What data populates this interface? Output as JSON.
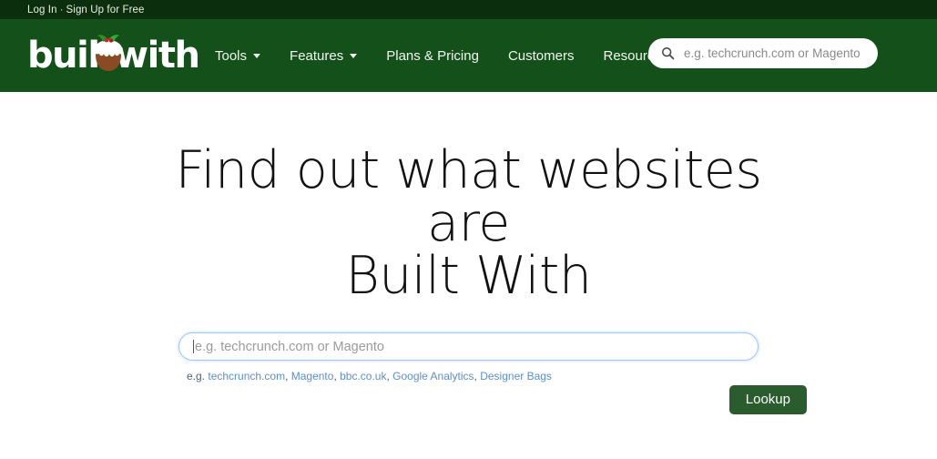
{
  "topbar": {
    "login_label": "Log In",
    "separator": "·",
    "signup_label": "Sign Up for Free"
  },
  "header": {
    "logo_text": "builtwith",
    "logo_icon": "christmas-pudding-icon",
    "nav": [
      {
        "label": "Tools",
        "has_dropdown": true
      },
      {
        "label": "Features",
        "has_dropdown": true
      },
      {
        "label": "Plans & Pricing",
        "has_dropdown": false
      },
      {
        "label": "Customers",
        "has_dropdown": false
      },
      {
        "label": "Resources",
        "has_dropdown": true
      }
    ],
    "search": {
      "icon": "search-icon",
      "placeholder": "e.g. techcrunch.com or Magento",
      "value": ""
    }
  },
  "hero": {
    "title_line1": "Find out what websites are",
    "title_line2": "Built With",
    "search": {
      "placeholder": "e.g. techcrunch.com or Magento",
      "value": ""
    },
    "examples_prefix": "e.g.",
    "examples": [
      "techcrunch.com",
      "Magento",
      "bbc.co.uk",
      "Google Analytics",
      "Designer Bags"
    ],
    "lookup_label": "Lookup"
  },
  "colors": {
    "topbar_green": "#0b2f0c",
    "nav_green": "#14501a",
    "button_green": "#2a5c2e",
    "link_blue": "#5b8fd4",
    "input_focus_border": "#9ec5fe"
  }
}
